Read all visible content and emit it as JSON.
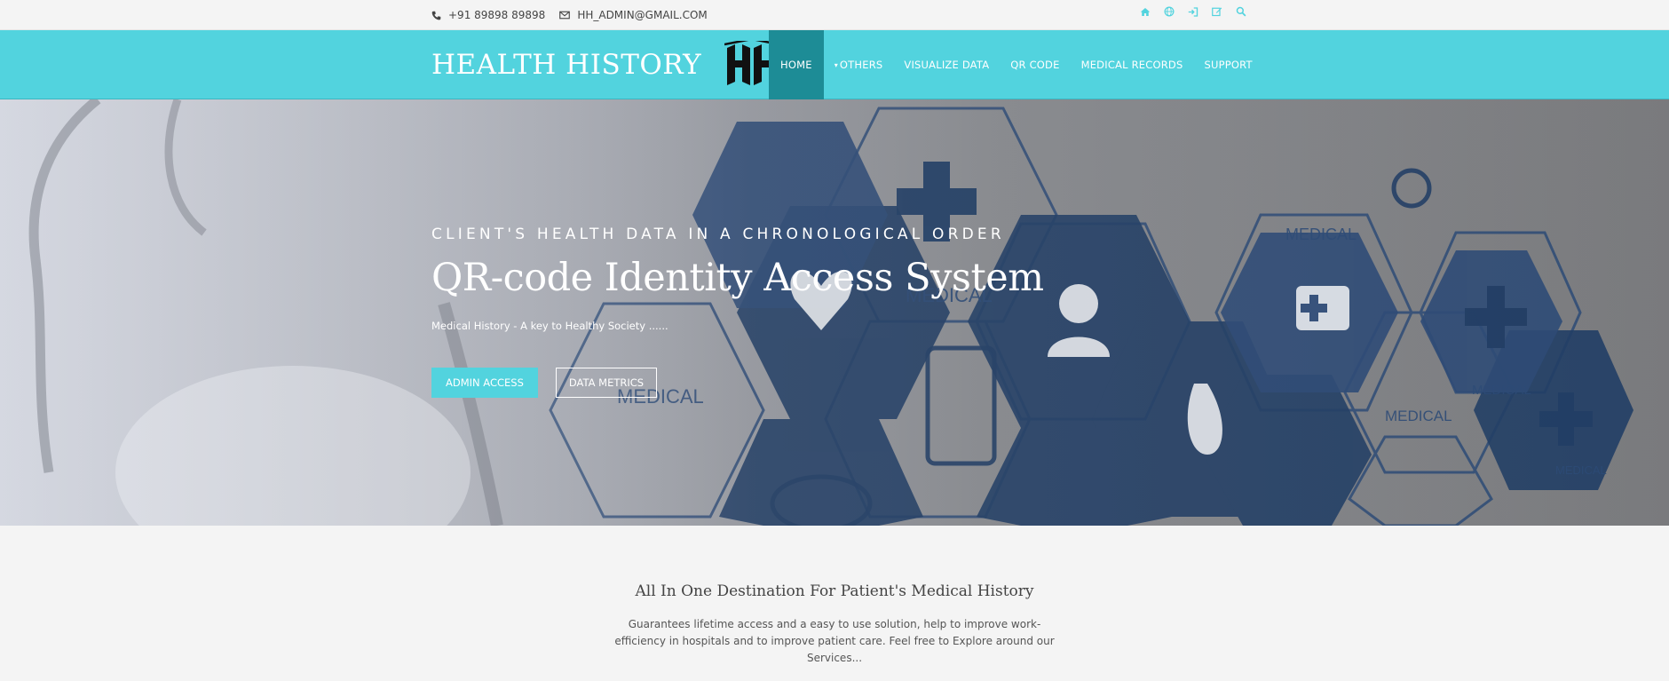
{
  "topbar": {
    "phone": "+91 89898 89898",
    "email": "HH_ADMIN@GMAIL.COM",
    "icons": [
      "home-icon",
      "globe-icon",
      "login-icon",
      "edit-icon",
      "search-icon"
    ]
  },
  "brand": {
    "name": "HEALTH HISTORY",
    "logo_text": "HH"
  },
  "nav": {
    "items": [
      {
        "label": "HOME",
        "active": true
      },
      {
        "label": "OTHERS",
        "dropdown": true
      },
      {
        "label": "VISUALIZE DATA"
      },
      {
        "label": "QR CODE"
      },
      {
        "label": "MEDICAL RECORDS"
      },
      {
        "label": "SUPPORT"
      }
    ]
  },
  "hero": {
    "kicker": "CLIENT'S HEALTH DATA IN A CHRONOLOGICAL ORDER",
    "headline": "QR-code Identity Access System",
    "subtext": "Medical History - A key to Healthy Society ......",
    "primary_button": "ADMIN ACCESS",
    "secondary_button": "DATA METRICS",
    "image_labels": [
      "MEDICAL",
      "MEDICAL",
      "MEDICAL",
      "MEDICAL",
      "MEDICAL",
      "MEDICAL"
    ]
  },
  "intro": {
    "title": "All In One Destination For Patient's Medical History",
    "description": "Guarantees lifetime access and a easy to use solution, help to improve work-efficiency in hospitals and to improve patient care. Feel free to Explore around our Services..."
  },
  "colors": {
    "accent": "#52d3de",
    "active_nav": "#1d8c96",
    "hex_dark": "#1e3a62",
    "background": "#f4f4f4"
  }
}
